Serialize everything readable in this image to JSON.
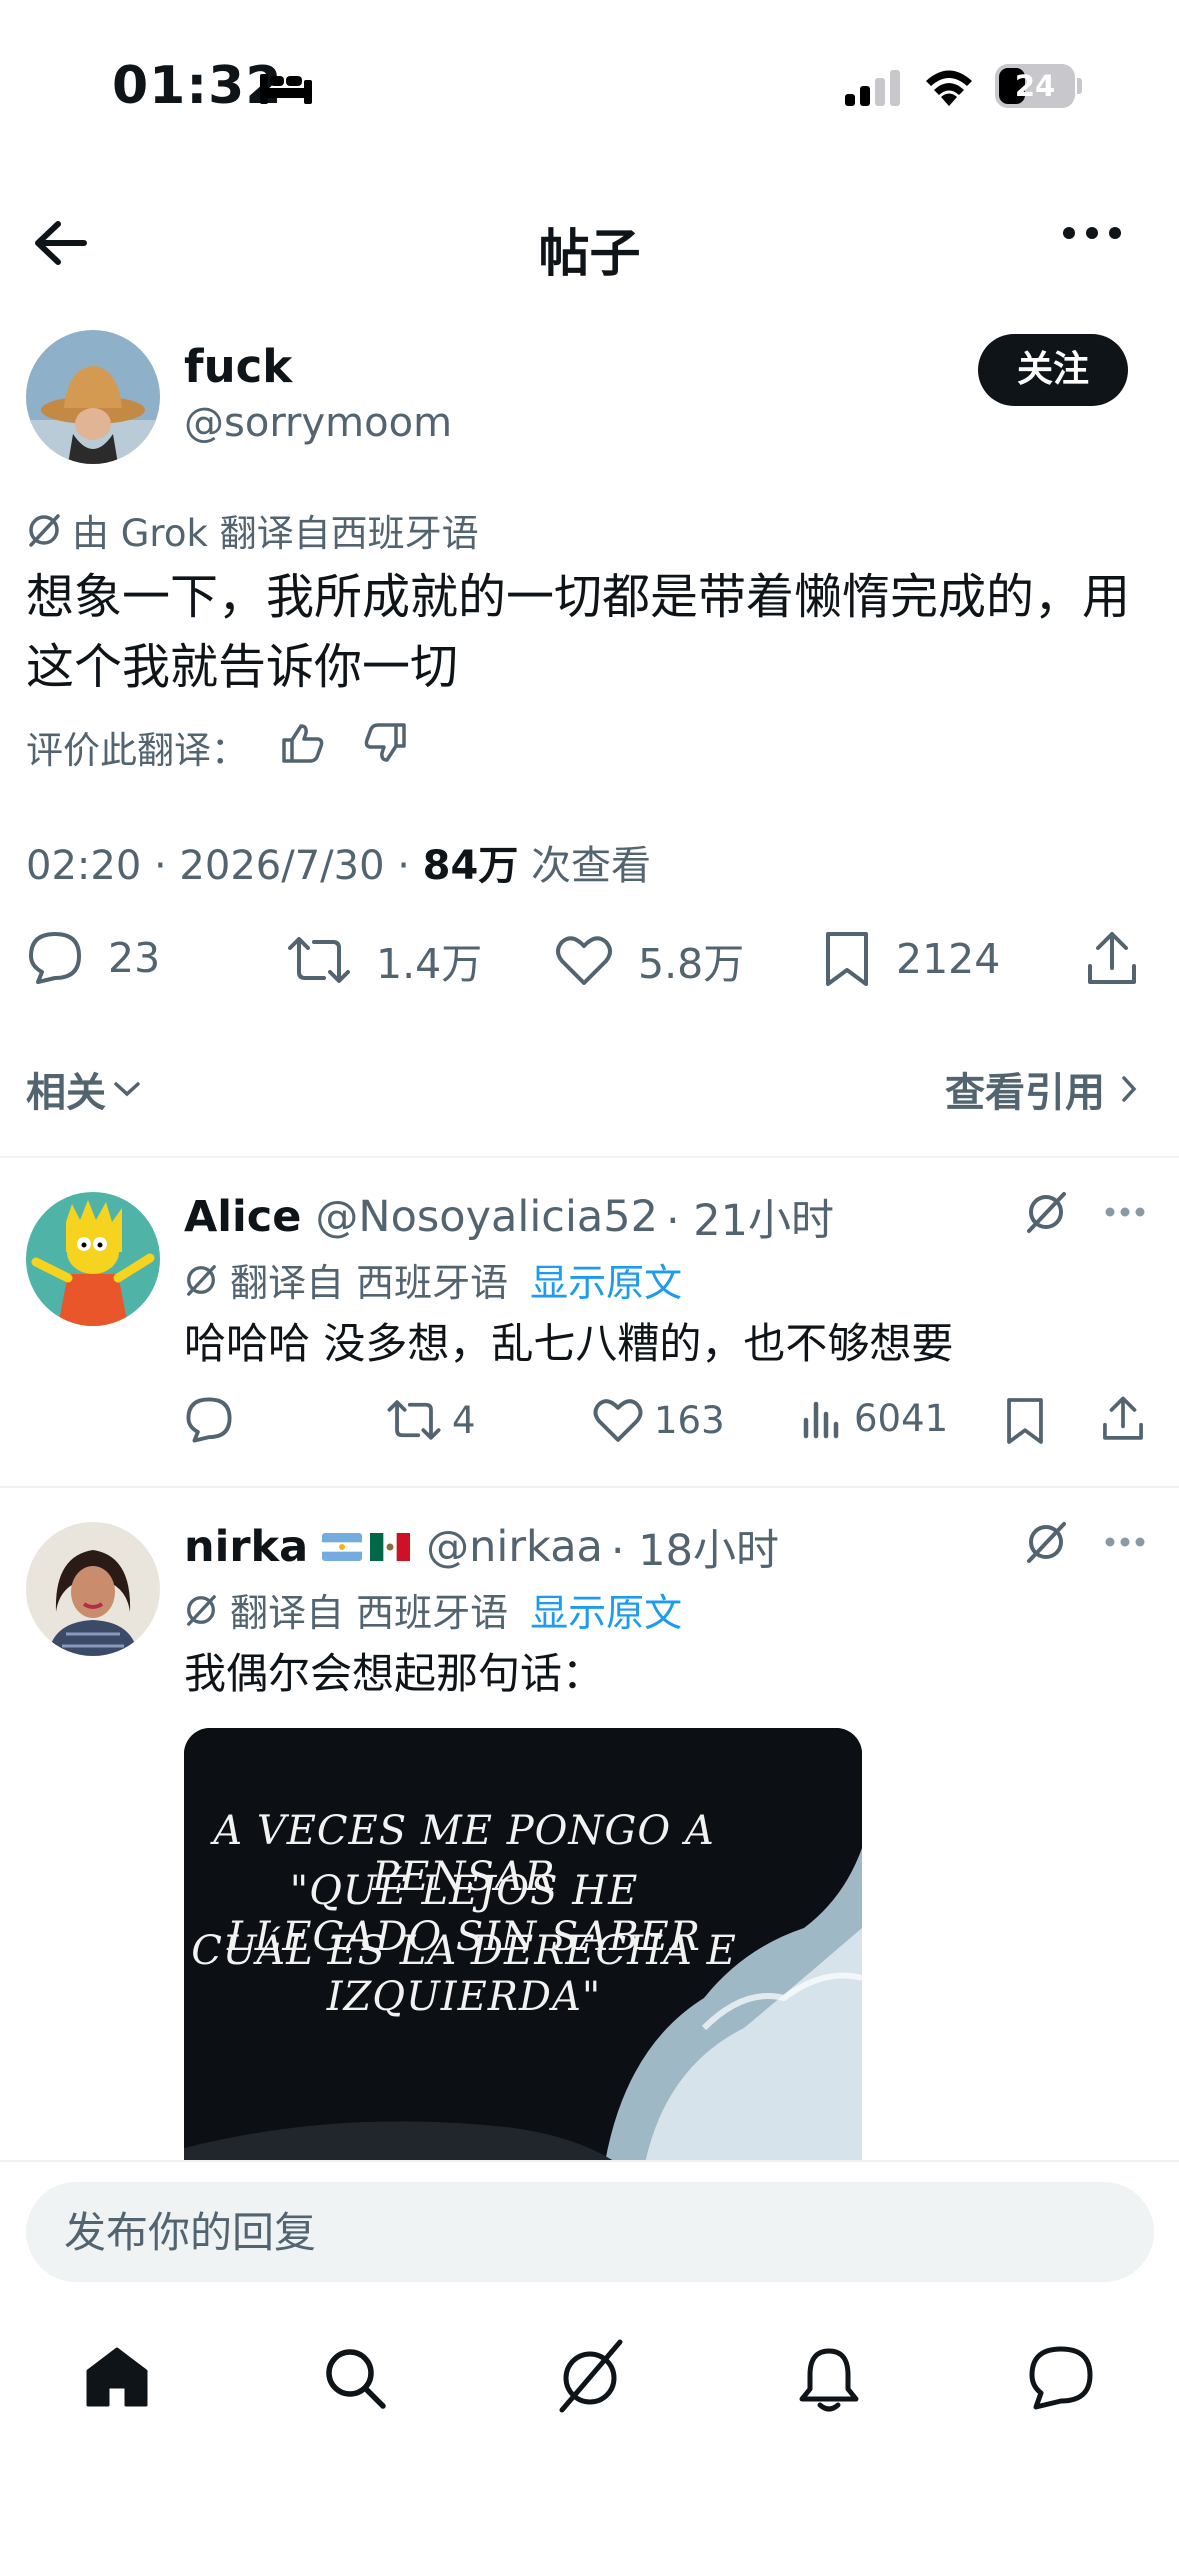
{
  "status_bar": {
    "time": "01:32",
    "battery": "24",
    "icons": [
      "bed-icon",
      "signal-icon",
      "wifi-icon",
      "battery-icon"
    ]
  },
  "header": {
    "title": "帖子",
    "back_icon": "arrow-left-icon",
    "more_icon": "more-horizontal-icon"
  },
  "post": {
    "author_name": "fuck",
    "author_handle": "@sorrymoom",
    "follow_label": "关注",
    "translation_note": "由 Grok 翻译自西班牙语",
    "text": "想象一下，我所成就的一切都是带着懒惰完成的，用这个我就告诉你一切",
    "rate_label": "评价此翻译：",
    "meta_time": "02:20 · 2026/7/30 · ",
    "views_count": "84万",
    "views_label": " 次查看",
    "actions": {
      "replies": "23",
      "reposts": "1.4万",
      "likes": "5.8万",
      "bookmarks": "2124"
    },
    "related_label": "相关",
    "view_quotes_label": "查看引用"
  },
  "replies": [
    {
      "name": "Alice",
      "handle": "@Nosoyalicia52",
      "time": "· 21小时",
      "translation": "翻译自 西班牙语",
      "show_original": "显示原文",
      "text": "哈哈哈 没多想，乱七八糟的，也不够想要",
      "actions": {
        "reposts": "4",
        "likes": "163",
        "views": "6041"
      }
    },
    {
      "name": "nirka",
      "flags": [
        "argentina-flag",
        "mexico-flag"
      ],
      "handle": "@nirkaa",
      "time": "· 18小时",
      "translation": "翻译自 西班牙语",
      "show_original": "显示原文",
      "text": "我偶尔会想起那句话：",
      "image_lines": [
        "A VECES ME PONGO A PENSAR",
        "\"QUÉ LEJOS HE LLEGADO SIN SABER",
        "CUÁL ES LA DERECHA E IZQUIERDA\""
      ]
    }
  ],
  "reply_bar": {
    "placeholder": "发布你的回复"
  },
  "tab_bar": [
    "home-icon",
    "search-icon",
    "grok-icon",
    "bell-icon",
    "messages-icon"
  ],
  "colors": {
    "text": "#0f1419",
    "secondary": "#536471",
    "link": "#1d9bf0",
    "divider": "#eff3f4"
  }
}
